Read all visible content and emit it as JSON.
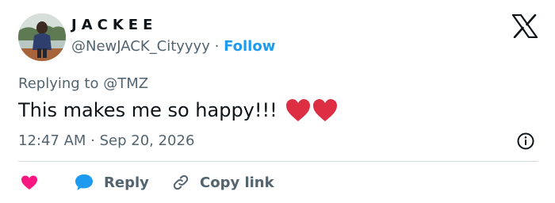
{
  "author": {
    "display_name": "JACKEE",
    "handle": "@NewJACK_Cityyyy",
    "separator": "·",
    "follow_label": "Follow"
  },
  "reply_context": {
    "text": "Replying to @TMZ"
  },
  "tweet": {
    "text": "This makes me so happy!!!",
    "emoji": [
      "red-heart",
      "red-heart"
    ]
  },
  "meta": {
    "timestamp": "12:47 AM · Sep 20, 2026"
  },
  "actions": {
    "like_label": "",
    "reply_label": "Reply",
    "copy_label": "Copy link"
  },
  "icons": {
    "x_logo": "x-logo-icon",
    "info": "info-icon",
    "like": "heart-icon",
    "reply": "speech-bubble-icon",
    "copy": "link-icon"
  },
  "colors": {
    "follow": "#1d9bf0",
    "like": "#f91880",
    "reply": "#1d9bf0",
    "muted": "#536471",
    "heart_emoji": "#dd2e44"
  }
}
